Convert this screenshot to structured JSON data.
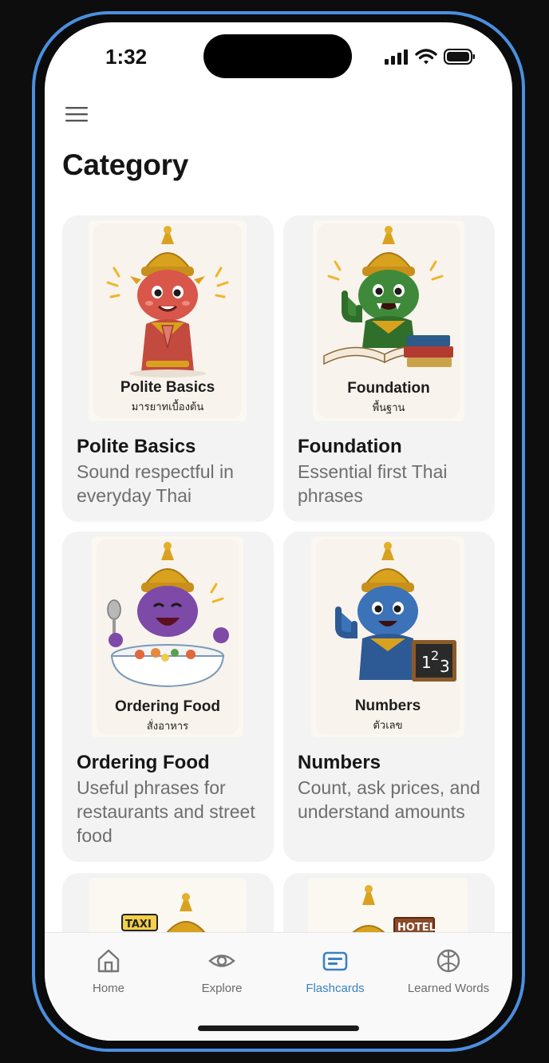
{
  "status_bar": {
    "time": "1:32"
  },
  "header": {
    "title": "Category"
  },
  "cards": [
    {
      "title": "Polite Basics",
      "description": "Sound respectful in everyday Thai",
      "image_label_en": "Polite Basics",
      "image_label_th": "มารยาทเบื้องต้น",
      "mascot_color": "#d9564a"
    },
    {
      "title": "Foundation",
      "description": "Essential first Thai phrases",
      "image_label_en": "Foundation",
      "image_label_th": "พื้นฐาน",
      "mascot_color": "#3f8a3a"
    },
    {
      "title": "Ordering Food",
      "description": "Useful phrases for restaurants and street food",
      "image_label_en": "Ordering Food",
      "image_label_th": "สั่งอาหาร",
      "mascot_color": "#7d4aa8"
    },
    {
      "title": "Numbers",
      "description": "Count, ask prices, and understand amounts",
      "image_label_en": "Numbers",
      "image_label_th": "ตัวเลข",
      "mascot_color": "#3c72b8"
    }
  ],
  "partial_cards": [
    {
      "sign_text": "TAXI"
    },
    {
      "sign_text": "HOTEL"
    }
  ],
  "tab_bar": {
    "tabs": [
      {
        "label": "Home",
        "icon": "home-icon",
        "active": false
      },
      {
        "label": "Explore",
        "icon": "eye-icon",
        "active": false
      },
      {
        "label": "Flashcards",
        "icon": "flashcards-icon",
        "active": true
      },
      {
        "label": "Learned Words",
        "icon": "brain-icon",
        "active": false
      }
    ]
  },
  "colors": {
    "accent": "#3b82c4",
    "frame": "#4a8fe0",
    "card_bg": "#f3f3f3"
  }
}
